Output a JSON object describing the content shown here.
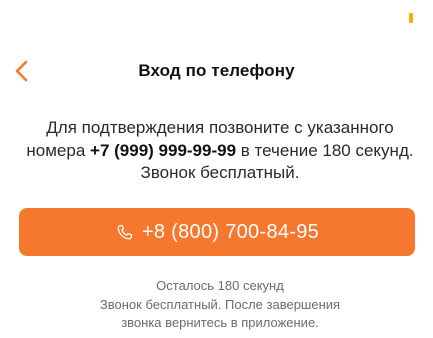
{
  "colors": {
    "accent": "#F6782F",
    "status_dot": "#F5B400"
  },
  "header": {
    "back_icon": "chevron-left-icon",
    "title": "Вход по телефону"
  },
  "instructions": {
    "before_number": "Для подтверждения позвоните с указанного номера ",
    "number": "+7 (999) 999-99-99",
    "after_number": " в течение 180 секунд. Звонок бесплатный."
  },
  "call_button": {
    "icon": "phone-icon",
    "number": "+8 (800) 700-84-95"
  },
  "footer": {
    "countdown": "Осталось 180 секунд",
    "note_line1": "Звонок бесплатный. После завершения",
    "note_line2": "звонка вернитесь в приложение."
  }
}
